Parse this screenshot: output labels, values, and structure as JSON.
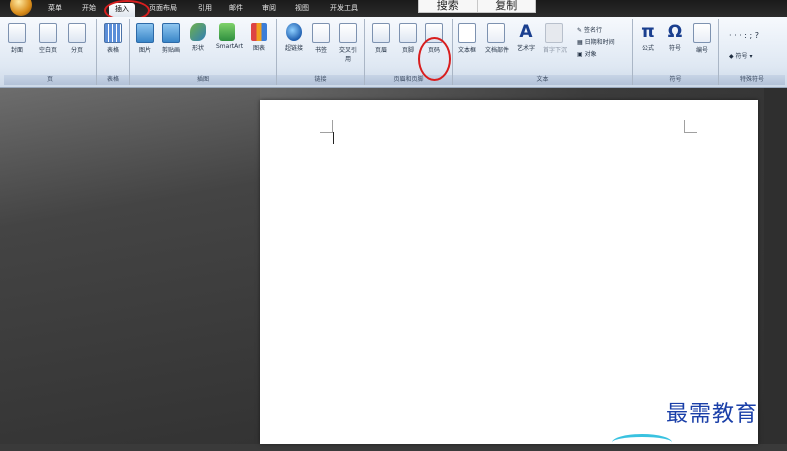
{
  "tabs": [
    "菜单",
    "开始",
    "插入",
    "页面布局",
    "引用",
    "邮件",
    "审阅",
    "视图",
    "开发工具"
  ],
  "active_tab_index": 2,
  "popup": {
    "search_label": "搜索",
    "copy_label": "复制"
  },
  "groups": {
    "pages": {
      "label": "页",
      "buttons": [
        "封面",
        "空白页",
        "分页"
      ]
    },
    "tables": {
      "label": "表格",
      "buttons": [
        "表格"
      ]
    },
    "illustrations": {
      "label": "插图",
      "buttons": [
        "图片",
        "剪贴画",
        "形状",
        "SmartArt",
        "图表"
      ]
    },
    "links": {
      "label": "链接",
      "buttons": [
        "超链接",
        "书签",
        "交叉引用"
      ]
    },
    "header_footer": {
      "label": "页眉和页脚",
      "buttons": [
        "页眉",
        "页脚",
        "页码"
      ]
    },
    "text": {
      "label": "文本",
      "buttons": [
        "文本框",
        "文档部件",
        "艺术字",
        "首字下沉"
      ],
      "small_items": [
        "签名行",
        "日期和时间",
        "对象"
      ]
    },
    "symbols": {
      "label": "符号",
      "buttons": [
        "公式",
        "符号",
        "编号"
      ]
    },
    "special": {
      "label": "特殊符号",
      "items": [
        "符号"
      ]
    }
  },
  "watermark": "最需教育"
}
